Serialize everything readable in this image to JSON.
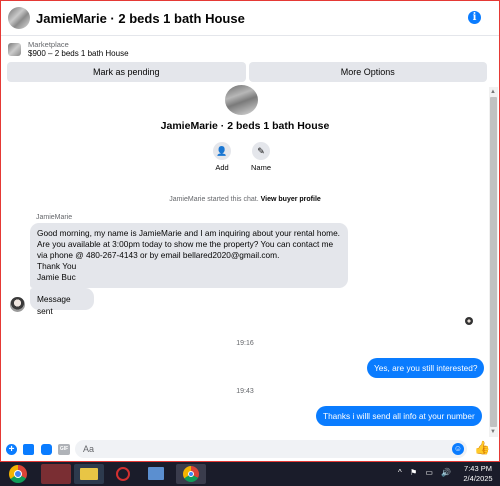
{
  "header": {
    "title": "JamieMarie · 2 beds 1 bath House",
    "info_icon": "info-icon"
  },
  "marketplace": {
    "label": "Marketplace",
    "listing": "$900 – 2 beds 1 bath House"
  },
  "actions": {
    "pending": "Mark as pending",
    "more": "More Options"
  },
  "profile": {
    "name": "JamieMarie · 2 beds 1 bath House",
    "add_label": "Add",
    "name_label": "Name"
  },
  "started": {
    "text": "JamieMarie started this chat.",
    "link": "View buyer profile"
  },
  "messages": {
    "sender": "JamieMarie",
    "incoming_main": "Good morning, my name is JamieMarie and I am inquiring about your rental home.\nAre you available at 3:00pm today to show me the property?  You can contact me via phone @ 480-267-4143 or by email bellared2020@gmail.com.\nThank You\nJamie Buc",
    "incoming_sent": "Message sent",
    "time1": "19:16",
    "outgoing1": "Yes, are you still interested?",
    "time2": "19:43",
    "outgoing2": "Thanks i willl send all info at your number"
  },
  "composer": {
    "placeholder": "Aa"
  },
  "taskbar": {
    "time": "7:43 PM",
    "date": "2/4/2025",
    "tray": "^ ⚑ ▭ 🔊"
  },
  "colors": {
    "accent": "#0a7cff",
    "bubble_in": "#e4e6eb"
  }
}
